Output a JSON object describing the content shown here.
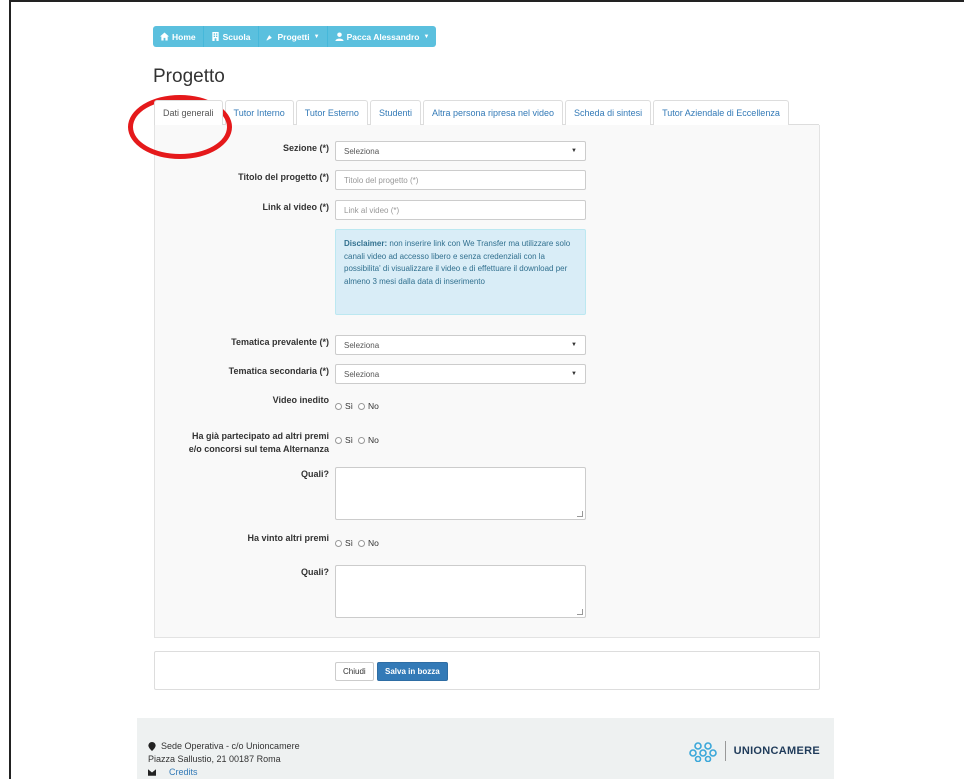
{
  "nav": {
    "home": "Home",
    "scuola": "Scuola",
    "progetti": "Progetti",
    "user": "Pacca Alessandro"
  },
  "page_title": "Progetto",
  "tabs": [
    "Dati generali",
    "Tutor Interno",
    "Tutor Esterno",
    "Studenti",
    "Altra persona ripresa nel video",
    "Scheda di sintesi",
    "Tutor Aziendale di Eccellenza"
  ],
  "form": {
    "sezione_label": "Sezione (*)",
    "sezione_value": "Seleziona",
    "titolo_label": "Titolo del progetto (*)",
    "titolo_placeholder": "Titolo del progetto (*)",
    "link_label": "Link al video (*)",
    "link_placeholder": "Link al video (*)",
    "disclaimer_title": "Disclaimer:",
    "disclaimer_text": " non inserire link con We Transfer ma utilizzare solo canali video ad accesso libero e senza credenziali con la possibilita' di visualizzare il video e di effettuare il download per almeno 3 mesi dalla data di inserimento",
    "tematica_prevalente_label": "Tematica prevalente (*)",
    "tematica_prevalente_value": "Seleziona",
    "tematica_secondaria_label": "Tematica secondaria (*)",
    "tematica_secondaria_value": "Seleziona",
    "video_inedito_label": "Video inedito",
    "partecipato_label_1": "Ha già partecipato ad altri premi",
    "partecipato_label_2": "e/o concorsi sul tema Alternanza",
    "quali_label": "Quali?",
    "vinto_label": "Ha vinto altri premi",
    "quali2_label": "Quali?",
    "yes": "Sì",
    "no": "No"
  },
  "buttons": {
    "close": "Chiudi",
    "save": "Salva in bozza"
  },
  "footer": {
    "address_line1": "Sede Operativa - c/o Unioncamere",
    "address_line2": "Piazza Sallustio, 21 00187 Roma",
    "credits": "Credits",
    "logo_text": "UNIONCAMERE"
  },
  "colors": {
    "nav_bg": "#5bc0de",
    "link": "#337ab7",
    "alert_bg": "#d9edf7",
    "annotation": "#e5191b"
  }
}
